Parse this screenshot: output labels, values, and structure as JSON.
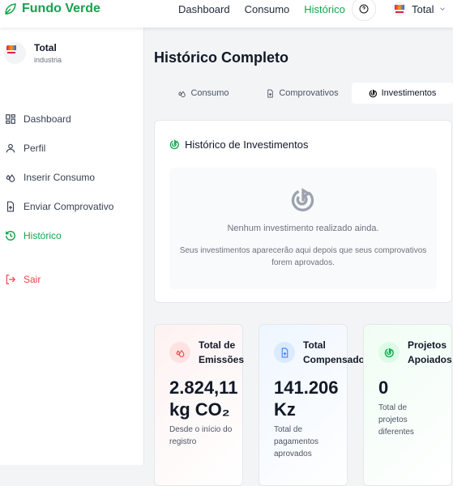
{
  "header": {
    "brand": "Fundo Verde",
    "nav": [
      "Dashboard",
      "Consumo",
      "Histórico"
    ],
    "active_nav": "Histórico",
    "user": "Total"
  },
  "sidebar": {
    "company_name": "Total",
    "company_type": "industria",
    "items": [
      {
        "label": "Dashboard",
        "icon": "grid-icon"
      },
      {
        "label": "Perfil",
        "icon": "user-icon"
      },
      {
        "label": "Inserir Consumo",
        "icon": "droplets-icon"
      },
      {
        "label": "Enviar Comprovativo",
        "icon": "file-upload-icon"
      },
      {
        "label": "Histórico",
        "icon": "history-icon",
        "active": true
      }
    ],
    "logout": "Sair"
  },
  "main": {
    "title": "Histórico Completo",
    "tabs": [
      {
        "label": "Consumo"
      },
      {
        "label": "Comprovativos"
      },
      {
        "label": "Investimentos",
        "active": true
      }
    ],
    "card": {
      "title": "Histórico de Investimentos",
      "empty_title": "Nenhum investimento realizado ainda.",
      "empty_desc": "Seus investimentos aparecerão aqui depois que seus comprovativos forem aprovados."
    },
    "stats": [
      {
        "title": "Total de Emissões",
        "value": "2.824,11 kg CO₂",
        "sub": "Desde o início do registro",
        "color": "#ef4444"
      },
      {
        "title": "Total Compensado",
        "value": "141.206 Kz",
        "sub": "Total de pagamentos aprovados",
        "color": "#3b82f6"
      },
      {
        "title": "Projetos Apoiados",
        "value": "0",
        "sub": "Total de projetos diferentes",
        "color": "#16a34a"
      }
    ]
  },
  "colors": {
    "accent": "#16a34a",
    "danger": "#ef4444"
  }
}
